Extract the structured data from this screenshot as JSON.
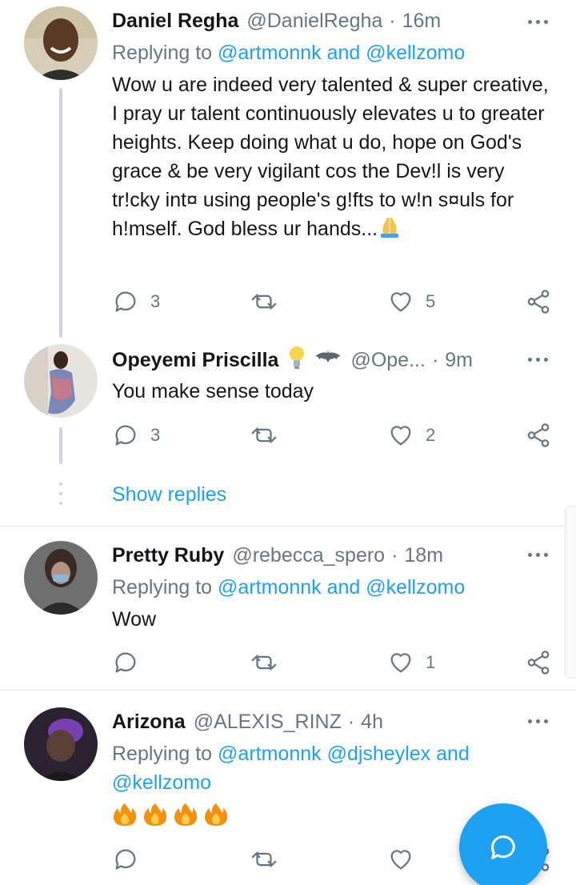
{
  "tweets": [
    {
      "name": "Daniel Regha",
      "handle": "@DanielRegha",
      "dot": "·",
      "time": "16m",
      "replying_prefix": "Replying to ",
      "mentions": "@artmonnk and @kellzomo",
      "text": "Wow u are indeed very talented & super creative, I pray ur talent continuously elevates u to greater heights. Keep doing what u do, hope on God's grace & be very vigilant cos the Dev!l is very tr!cky int¤ using people's g!fts to w!n s¤uls for h!mself. God bless ur hands...",
      "emoji": "folded-hands-emoji",
      "reply_count": "3",
      "like_count": "5",
      "avatar_color": "#b9a98c"
    },
    {
      "name": "Opeyemi Priscilla",
      "name_emojis": [
        "light-bulb-emoji",
        "bat-emoji"
      ],
      "handle": "@Ope...",
      "dot": "·",
      "time": "9m",
      "text": "You make sense today",
      "reply_count": "3",
      "like_count": "2",
      "avatar_color": "#9aa6c2"
    },
    {
      "name": "Pretty Ruby",
      "handle": "@rebecca_spero",
      "dot": "·",
      "time": "18m",
      "replying_prefix": "Replying to ",
      "mentions": "@artmonnk and @kellzomo",
      "text": "Wow",
      "reply_count": "",
      "like_count": "1",
      "avatar_color": "#8c8c8c"
    },
    {
      "name": "Arizona",
      "handle": "@ALEXIS_RINZ",
      "dot": "·",
      "time": "4h",
      "replying_prefix": "Replying to ",
      "mentions": "@artmonnk @djsheylex and",
      "mentions_line2": "@kellzomo",
      "emoji": "fire-emoji x4",
      "reply_count": "",
      "like_count": "",
      "avatar_color": "#4a3a5a"
    }
  ],
  "show_replies_label": "Show replies",
  "icons": {
    "reply": "reply-icon",
    "retweet": "retweet-icon",
    "like": "like-icon",
    "share": "share-icon",
    "more": "more-icon",
    "compose": "compose-reply-icon"
  },
  "colors": {
    "accent": "#1da1f2",
    "muted": "#657786",
    "text": "#14171a",
    "thread_line": "#ccd6dd"
  }
}
